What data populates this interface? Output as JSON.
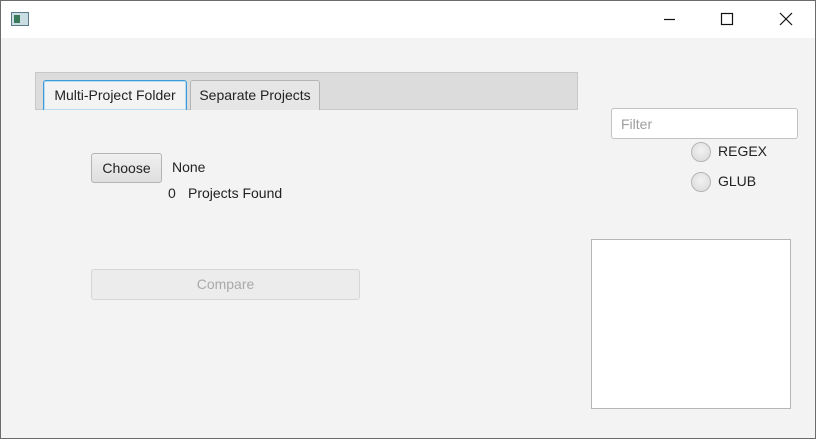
{
  "titlebar": {
    "title": "",
    "icon": "app-window-icon",
    "controls": [
      "minimize-icon",
      "maximize-icon",
      "close-icon"
    ]
  },
  "tabs": [
    {
      "label": "Multi-Project Folder",
      "selected": true
    },
    {
      "label": "Separate Projects",
      "selected": false
    }
  ],
  "main": {
    "choose_label": "Choose",
    "folder_value": "None",
    "projects_count": "0",
    "projects_found_label": "Projects Found",
    "compare_label": "Compare",
    "compare_enabled": false
  },
  "filter": {
    "placeholder": "Filter",
    "value": ""
  },
  "match_modes": [
    {
      "label": "REGEX",
      "selected": false
    },
    {
      "label": "GLUB",
      "selected": false
    }
  ],
  "results_list": [],
  "colors": {
    "window_bg": "#f3f3f3",
    "tab_focus": "#3c9ad8",
    "disabled_text": "#a9a9a9"
  }
}
